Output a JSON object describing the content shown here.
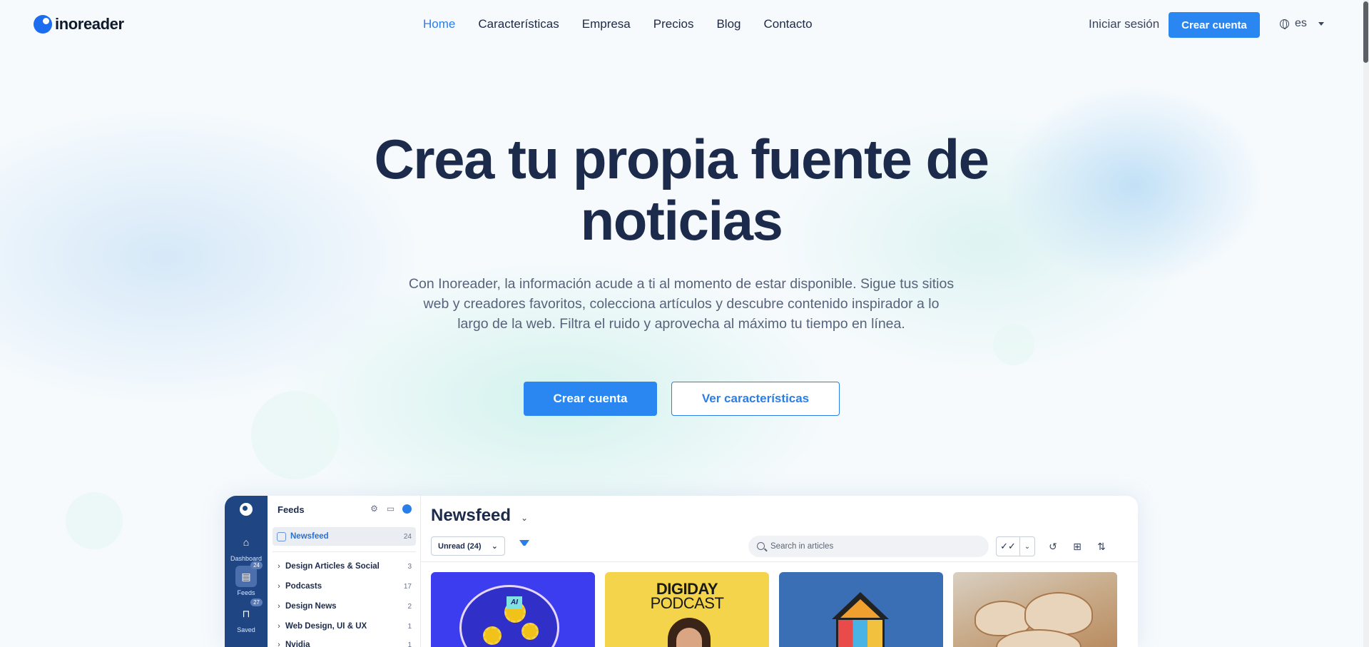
{
  "brand": {
    "name": "inoreader"
  },
  "nav": {
    "items": [
      "Home",
      "Características",
      "Empresa",
      "Precios",
      "Blog",
      "Contacto"
    ],
    "active": "Home"
  },
  "header": {
    "signin": "Iniciar sesión",
    "signup": "Crear cuenta",
    "language": "es"
  },
  "hero": {
    "title": "Crea tu propia fuente de noticias",
    "subtitle": "Con Inoreader, la información acude a ti al momento de estar disponible. Sigue tus sitios web y creadores favoritos, colecciona artículos y descubre contenido inspirador a lo largo de la web. Filtra el ruido y aprovecha al máximo tu tiempo en línea.",
    "cta_primary": "Crear cuenta",
    "cta_secondary": "Ver características"
  },
  "app_preview": {
    "rail": [
      {
        "label": "Dashboard",
        "icon": "home-icon",
        "badge": ""
      },
      {
        "label": "Feeds",
        "icon": "feeds-icon",
        "badge": "24"
      },
      {
        "label": "Saved",
        "icon": "bookmark-icon",
        "badge": "27"
      }
    ],
    "feeds_panel": {
      "title": "Feeds",
      "selected": {
        "name": "Newsfeed",
        "count": "24"
      },
      "folders": [
        {
          "name": "Design Articles & Social",
          "count": "3"
        },
        {
          "name": "Podcasts",
          "count": "17"
        },
        {
          "name": "Design News",
          "count": "2"
        },
        {
          "name": "Web Design, UI & UX",
          "count": "1"
        },
        {
          "name": "Nvidia",
          "count": "1"
        }
      ]
    },
    "main": {
      "title": "Newsfeed",
      "filter_label": "Unread (24)",
      "search_placeholder": "Search in articles",
      "cards": [
        {
          "theme": "ai-brain",
          "caption": "AI",
          "color": "#3d3df0"
        },
        {
          "theme": "podcast",
          "caption": "DIGIDAY",
          "subcaption": "PODCAST",
          "color": "#f4d44a"
        },
        {
          "theme": "puzzle-house",
          "caption": "",
          "color": "#3a6fb5"
        },
        {
          "theme": "architecture",
          "caption": "",
          "color": "#c9ad8c"
        }
      ]
    }
  },
  "colors": {
    "accent": "#2a86f0",
    "title": "#1c2b4b",
    "rail": "#1f4582"
  }
}
